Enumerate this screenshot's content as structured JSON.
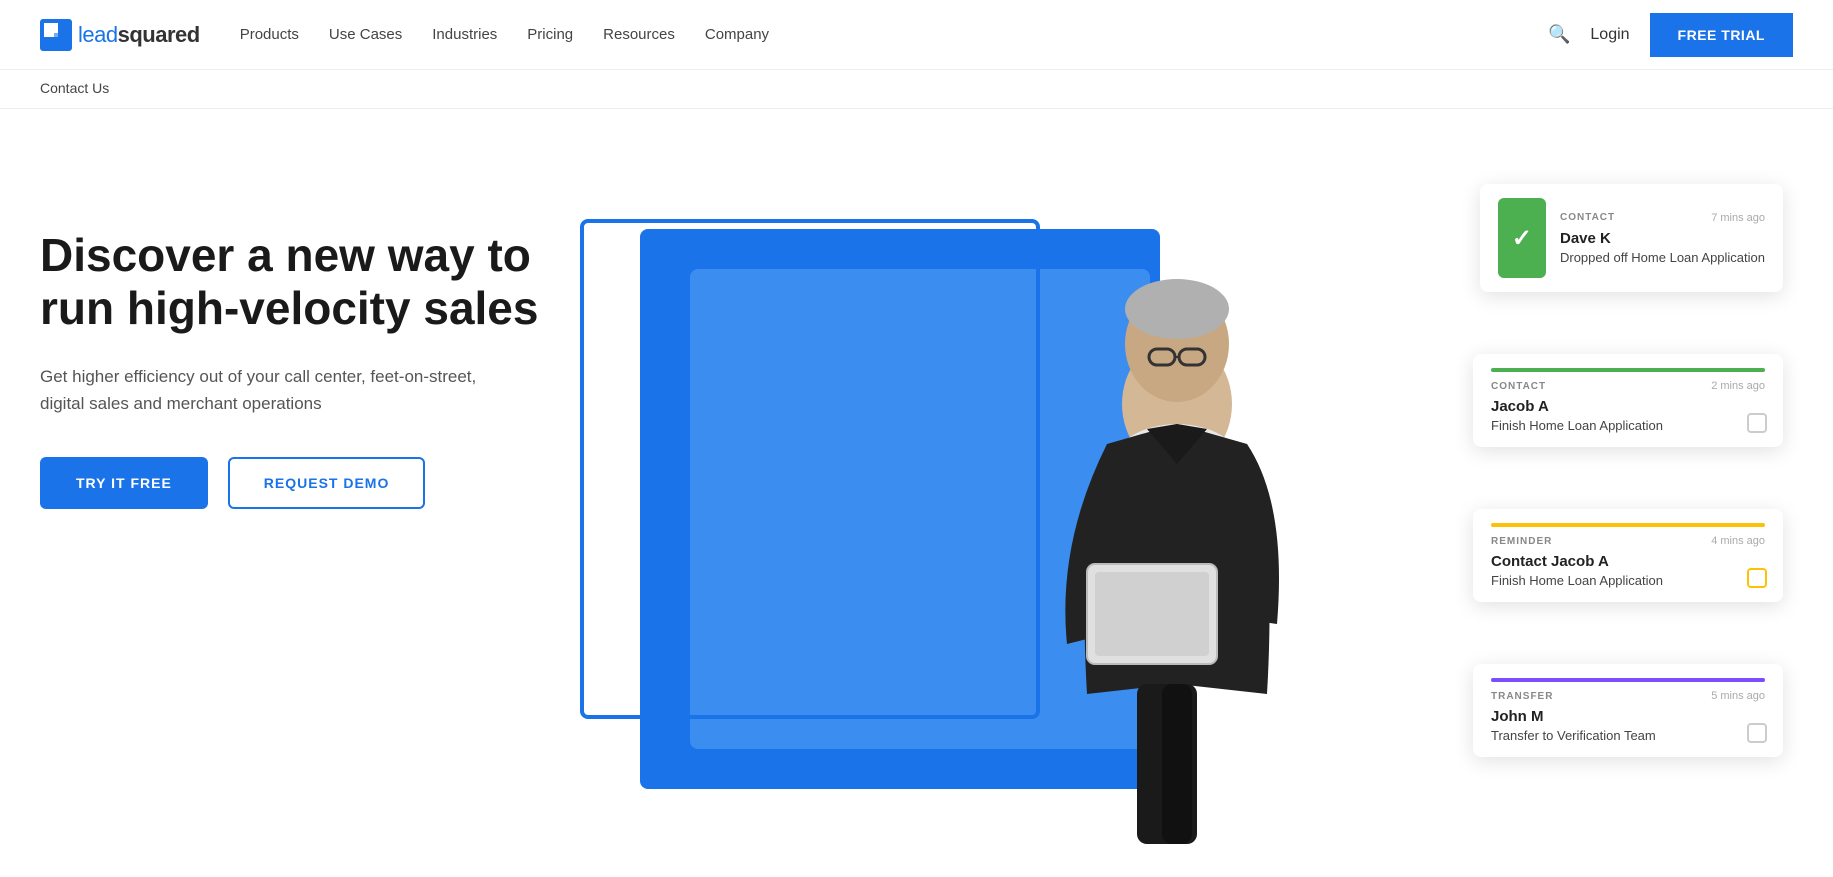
{
  "brand": {
    "logo_text_lead": "lead",
    "logo_text_squared": "squared"
  },
  "nav": {
    "items": [
      {
        "label": "Products",
        "id": "products"
      },
      {
        "label": "Use Cases",
        "id": "use-cases"
      },
      {
        "label": "Industries",
        "id": "industries"
      },
      {
        "label": "Pricing",
        "id": "pricing"
      },
      {
        "label": "Resources",
        "id": "resources"
      },
      {
        "label": "Company",
        "id": "company"
      }
    ],
    "login_label": "Login",
    "free_trial_label": "FREE TRIAL",
    "contact_us_label": "Contact Us"
  },
  "hero": {
    "heading": "Discover a new way to run high-velocity sales",
    "subtext": "Get higher efficiency out of your call center, feet-on-street, digital sales and merchant operations",
    "btn_try": "TRY IT FREE",
    "btn_demo": "REQUEST DEMO"
  },
  "cards": {
    "card1": {
      "tag": "CONTACT",
      "time": "7 mins ago",
      "name": "Dave K",
      "action": "Dropped off Home Loan Application"
    },
    "card2": {
      "tag": "CONTACT",
      "time": "2 mins ago",
      "name": "Jacob A",
      "action": "Finish Home Loan Application",
      "bar_color": "green"
    },
    "card3": {
      "tag": "REMINDER",
      "time": "4 mins ago",
      "name": "Contact Jacob A",
      "action": "Finish Home Loan Application",
      "bar_color": "yellow"
    },
    "card4": {
      "tag": "TRANSFER",
      "time": "5 mins ago",
      "name": "John M",
      "action": "Transfer to Verification Team",
      "bar_color": "purple"
    }
  }
}
